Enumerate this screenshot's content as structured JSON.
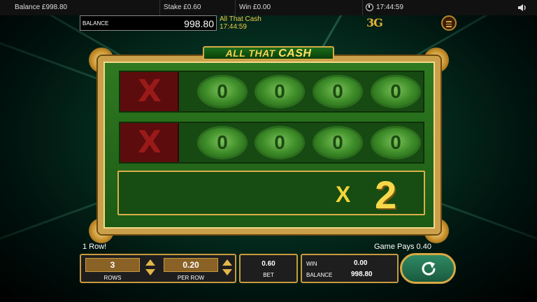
{
  "topbar": {
    "balance_text": "Balance £998.80",
    "stake_text": "Stake £0.60",
    "win_text": "Win £0.00",
    "time": "17:44:59"
  },
  "infobar": {
    "balance_label": "BALANCE",
    "balance_value": "998.80",
    "game_name": "All That Cash",
    "time": "17:44:59",
    "logo_text": "3"
  },
  "game": {
    "title_main": "ALL THAT",
    "title_accent": "CASH",
    "rows": [
      {
        "marker": "X",
        "symbols": [
          "0",
          "0",
          "0",
          "0"
        ]
      },
      {
        "marker": "X",
        "symbols": [
          "0",
          "0",
          "0",
          "0"
        ]
      }
    ],
    "multiplier_symbol": "X",
    "multiplier_value": "2"
  },
  "messages": {
    "left": "1 Row!",
    "right": "Game Pays 0.40"
  },
  "controls": {
    "rows_value": "3",
    "rows_label": "ROWS",
    "per_row_value": "0.20",
    "per_row_label": "PER ROW",
    "bet_value": "0.60",
    "bet_label": "BET",
    "win_label": "WIN",
    "win_value": "0.00",
    "balance_label": "BALANCE",
    "balance_value": "998.80"
  },
  "icons": {
    "clock": "clock-icon",
    "speaker": "speaker-icon",
    "menu": "hamburger-menu-icon",
    "spin": "refresh-arrow-icon"
  },
  "colors": {
    "gold": "#caa04a",
    "green_felt": "#1c5a14",
    "red_cell": "#5c0c0c",
    "spin_green": "#1a5a3f"
  }
}
